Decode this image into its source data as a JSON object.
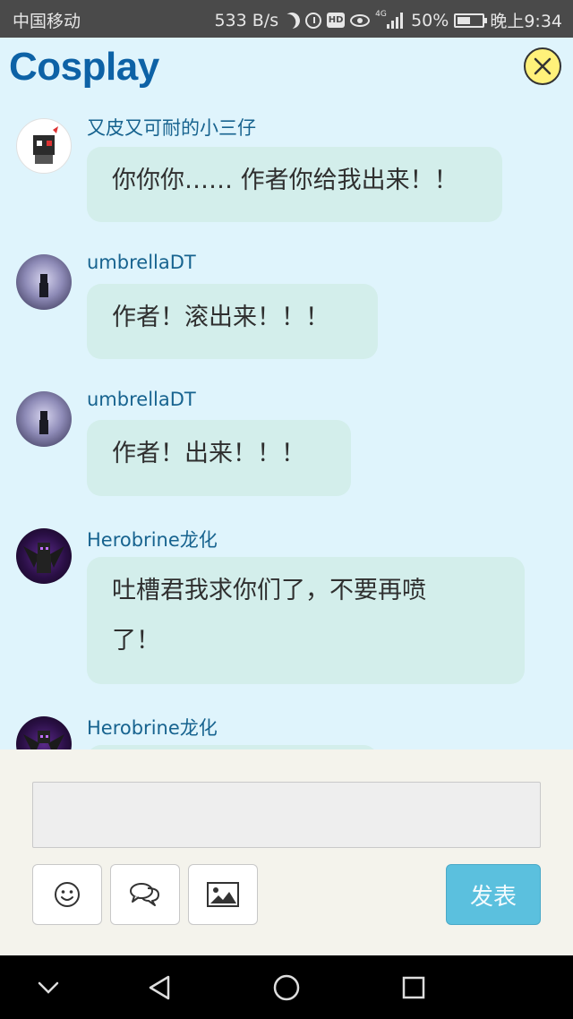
{
  "status_bar": {
    "carrier": "中国移动",
    "network_speed": "533 B/s",
    "network_type": "4G",
    "battery": "50%",
    "time": "晚上9:34",
    "icons": [
      "moon-icon",
      "alarm-icon",
      "hd-icon",
      "eye-icon",
      "signal-icon",
      "battery-icon"
    ]
  },
  "header": {
    "title": "Cosplay",
    "close_icon": "close-icon",
    "colors": {
      "title": "#0d62a6",
      "close_bg": "#fff17a"
    }
  },
  "messages": [
    {
      "username": "又皮又可耐的小三仔",
      "text": "你你你…… 作者你给我出来！！",
      "avatar": "avatar-white-character"
    },
    {
      "username": "umbrellaDT",
      "text": "作者！滚出来！！！",
      "avatar": "avatar-dark-figure"
    },
    {
      "username": "umbrellaDT",
      "text": "作者！出来！！！",
      "avatar": "avatar-dark-figure"
    },
    {
      "username": "Herobrine龙化",
      "text": "吐槽君我求你们了，不要再喷了！",
      "text_lines": [
        "吐槽君我求你们了，不要再喷",
        "了！"
      ],
      "avatar": "avatar-purple-dragon"
    },
    {
      "username": "Herobrine龙化",
      "text": "",
      "avatar": "avatar-purple-dragon"
    }
  ],
  "composer": {
    "input_value": "",
    "tools": [
      "smiley-icon",
      "chat-bubbles-icon",
      "image-icon"
    ],
    "send_label": "发表",
    "colors": {
      "send_bg": "#5bc0de",
      "bubble_bg": "#d3eeeb",
      "page_bg": "#dff4fc"
    }
  },
  "nav_bar": {
    "icons": [
      "chevron-down-icon",
      "back-triangle-icon",
      "home-circle-icon",
      "recents-square-icon"
    ]
  }
}
